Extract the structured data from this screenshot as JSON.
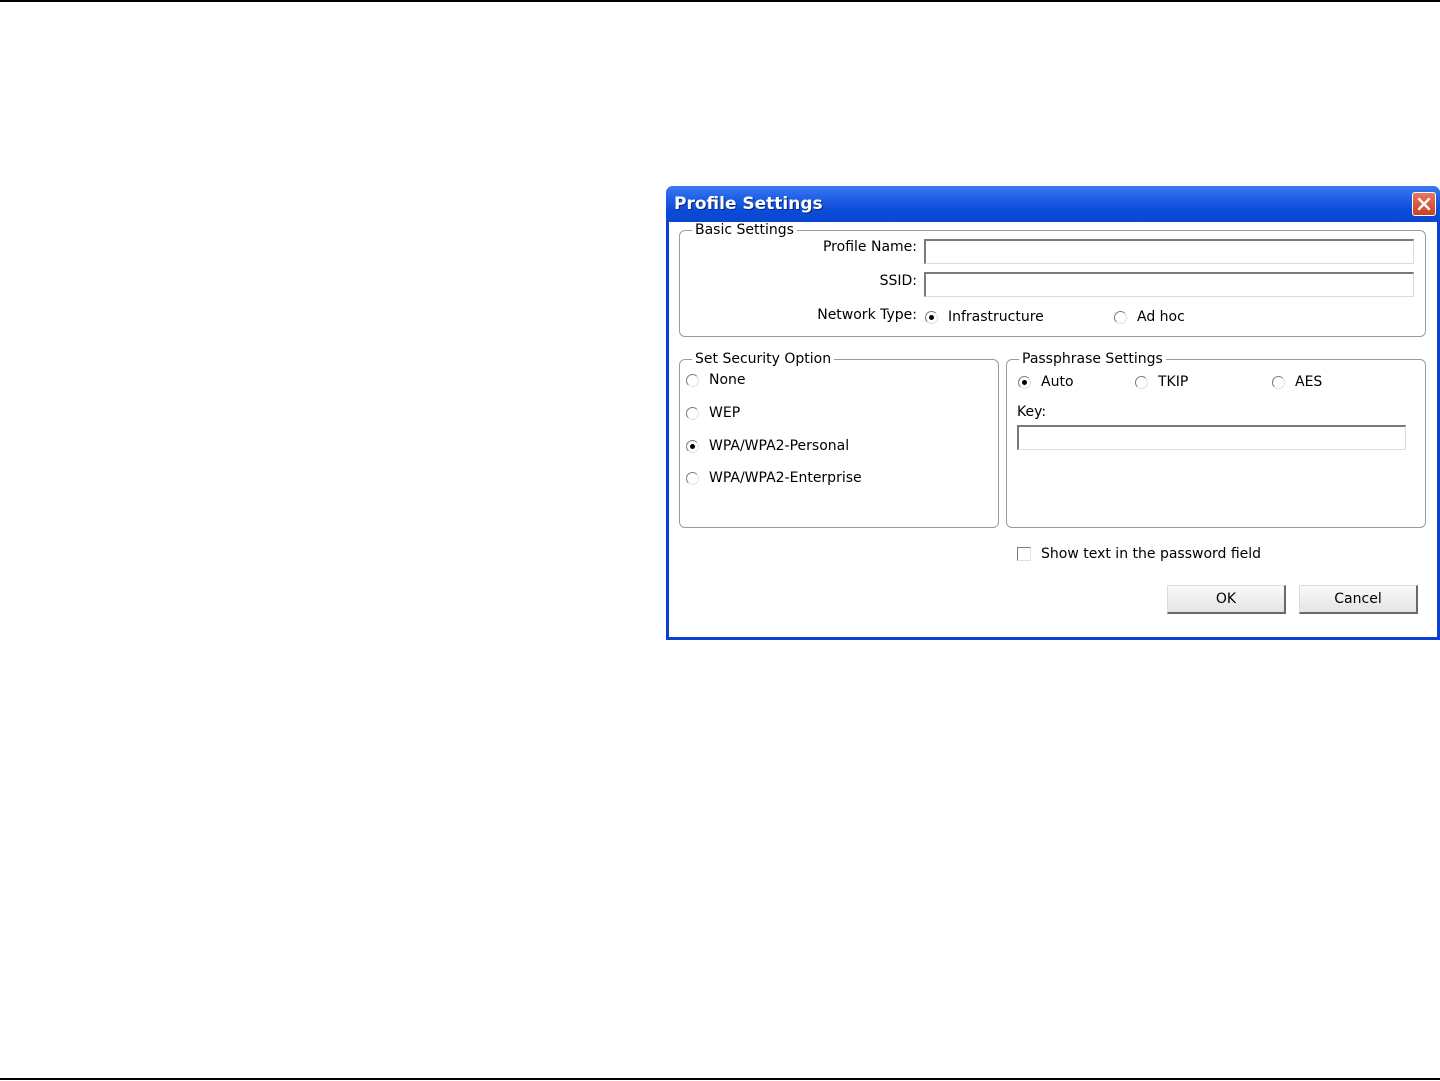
{
  "dialog": {
    "title": "Profile Settings",
    "close_icon": "close-icon"
  },
  "basic_settings": {
    "legend": "Basic Settings",
    "profile_name_label": "Profile Name:",
    "profile_name_value": "",
    "ssid_label": "SSID:",
    "ssid_value": "",
    "network_type_label": "Network Type:",
    "network_types": [
      {
        "label": "Infrastructure",
        "selected": true
      },
      {
        "label": "Ad hoc",
        "selected": false
      }
    ]
  },
  "security": {
    "legend": "Set Security Option",
    "options": [
      {
        "label": "None",
        "selected": false
      },
      {
        "label": "WEP",
        "selected": false
      },
      {
        "label": "WPA/WPA2-Personal",
        "selected": true
      },
      {
        "label": "WPA/WPA2-Enterprise",
        "selected": false
      }
    ]
  },
  "passphrase": {
    "legend": "Passphrase Settings",
    "ciphers": [
      {
        "label": "Auto",
        "selected": true
      },
      {
        "label": "TKIP",
        "selected": false
      },
      {
        "label": "AES",
        "selected": false
      }
    ],
    "key_label": "Key:",
    "key_value": ""
  },
  "show_text": {
    "label": "Show text in the password field",
    "checked": false
  },
  "buttons": {
    "ok_label": "OK",
    "cancel_label": "Cancel"
  }
}
